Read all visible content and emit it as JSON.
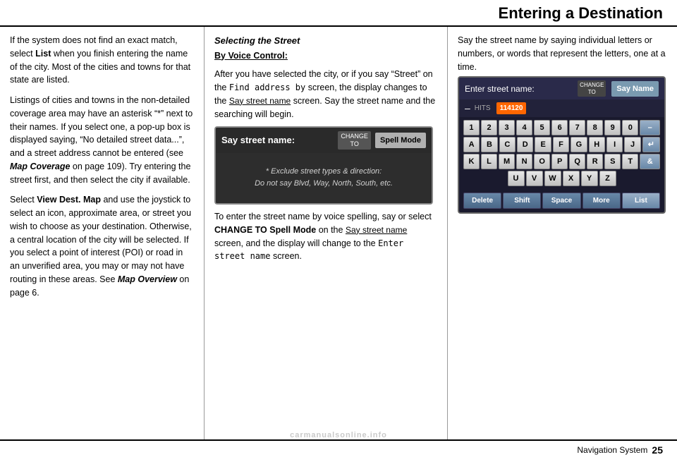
{
  "page": {
    "title": "Entering a Destination",
    "footer_text": "Navigation System",
    "footer_page": "25"
  },
  "left_col": {
    "para1": "If the system does not find an exact match, select List when you finish entering the name of the city. Most of the cities and towns for that state are listed.",
    "para2": "Listings of cities and towns in the non-detailed coverage area may have an asterisk “*” next to their names. If you select one, a pop-up box is displayed saying, “No detailed street data...”, and a street address cannot be entered (see Map Coverage on page 109). Try entering the street first, and then select the city if available.",
    "para3_start": "Select ",
    "para3_bold": "View Dest. Map",
    "para3_end": " and use the joystick to select an icon, approximate area, or street you wish to choose as your destination. Otherwise, a central location of the city will be selected. If you select a point of interest (POI) or road in an unverified area, you may or may not have routing in these areas. See ",
    "para3_italic": "Map Overview",
    "para3_page": " on page 6."
  },
  "mid_col": {
    "section_title": "Selecting the Street",
    "sub_title": "By Voice Control:",
    "para1": "After you have selected the city, or if you say “Street” on the Find address by screen, the display changes to the Say street name screen. Say the street name and the searching will begin.",
    "screen": {
      "label": "Say street name:",
      "change_to": "CHANGE\nTO",
      "spell_mode": "Spell Mode",
      "note_line1": "* Exclude street types & direction:",
      "note_line2": "Do not say Blvd, Way, North, South, etc."
    },
    "para2_start": "To enter the street name by voice spelling, say or select ",
    "para2_bold": "CHANGE TO Spell Mode",
    "para2_mid": " on the Say street name screen, and the display will change to the ",
    "para2_mono": "Enter street name",
    "para2_end": " screen."
  },
  "right_col": {
    "intro": "Say the street name by saying individual letters or numbers, or words that represent the letters, one at a time.",
    "keyboard_screen": {
      "header_label": "Enter street name:",
      "change_to": "CHANGE\nTO",
      "say_name_btn": "Say Name",
      "minus_symbol": "–",
      "hits_label": "HITS",
      "hits_value": "114120",
      "rows": [
        [
          "1",
          "2",
          "3",
          "4",
          "5",
          "6",
          "7",
          "8",
          "9",
          "0",
          "–"
        ],
        [
          "A",
          "B",
          "C",
          "D",
          "E",
          "F",
          "G",
          "H",
          "I",
          "J",
          "↵"
        ],
        [
          "K",
          "L",
          "M",
          "N",
          "O",
          "P",
          "Q",
          "R",
          "S",
          "T",
          "&"
        ],
        [
          "U",
          "V",
          "W",
          "X",
          "Y",
          "Z"
        ],
        [
          "Delete",
          "Shift",
          "Space",
          "More",
          "List"
        ]
      ]
    }
  }
}
